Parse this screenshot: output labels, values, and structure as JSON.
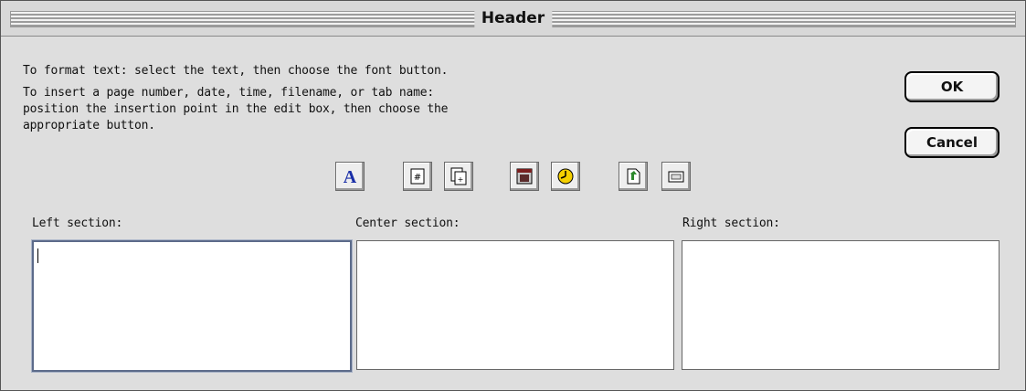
{
  "window": {
    "title": "Header"
  },
  "instructions": {
    "line1": "To format text:  select the text, then choose the font button.",
    "line2": "To insert a page number, date, time, filename, or tab name:",
    "line3": "position the insertion point in the edit box, then choose the",
    "line4": "appropriate button."
  },
  "buttons": {
    "ok": "OK",
    "cancel": "Cancel"
  },
  "toolbar": {
    "icons": [
      "font-icon",
      "page-number-icon",
      "total-pages-icon",
      "date-icon",
      "time-icon",
      "filename-icon",
      "tab-name-icon"
    ]
  },
  "sections": {
    "left": {
      "label": "Left section:",
      "value": ""
    },
    "center": {
      "label": "Center section:",
      "value": ""
    },
    "right": {
      "label": "Right section:",
      "value": ""
    }
  },
  "colors": {
    "font_icon": "#1a2fa8",
    "time_icon": "#f5d000",
    "filename_icon": "#2d8a2d",
    "date_icon": "#7a1f1f"
  }
}
